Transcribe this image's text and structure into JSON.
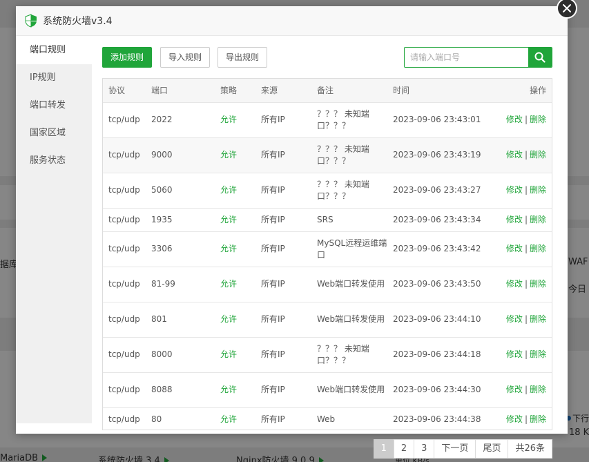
{
  "background": {
    "left_fragment": "据库",
    "right_fragment_1": "WAF",
    "right_fragment_2": "今日",
    "right_fragment_3": "下行",
    "right_fragment_4": "18 K",
    "bottom_items": [
      "MariaDB",
      "系统防火墙 3.4",
      "Nginx防火墙 9.0.9"
    ],
    "bottom_fragment": "单位 KB/s"
  },
  "dialog": {
    "title": "系统防火墙v3.4",
    "sidebar": [
      "端口规则",
      "IP规则",
      "端口转发",
      "国家区域",
      "服务状态"
    ],
    "toolbar": {
      "add_rule": "添加规则",
      "import_rule": "导入规则",
      "export_rule": "导出规则",
      "search_placeholder": "请输入端口号"
    },
    "columns": [
      "协议",
      "端口",
      "策略",
      "来源",
      "备注",
      "时间",
      "操作"
    ],
    "rows": [
      {
        "protocol": "tcp/udp",
        "port": "2022",
        "policy": "允许",
        "source": "所有IP",
        "note": "？？？ 未知端口？？？",
        "time": "2023-09-06 23:43:01"
      },
      {
        "protocol": "tcp/udp",
        "port": "9000",
        "policy": "允许",
        "source": "所有IP",
        "note": "？？？ 未知端口？？？",
        "time": "2023-09-06 23:43:19"
      },
      {
        "protocol": "tcp/udp",
        "port": "5060",
        "policy": "允许",
        "source": "所有IP",
        "note": "？？？ 未知端口？？？",
        "time": "2023-09-06 23:43:27"
      },
      {
        "protocol": "tcp/udp",
        "port": "1935",
        "policy": "允许",
        "source": "所有IP",
        "note": "SRS",
        "time": "2023-09-06 23:43:34"
      },
      {
        "protocol": "tcp/udp",
        "port": "3306",
        "policy": "允许",
        "source": "所有IP",
        "note": "MySQL远程运维端口",
        "time": "2023-09-06 23:43:42"
      },
      {
        "protocol": "tcp/udp",
        "port": "81-99",
        "policy": "允许",
        "source": "所有IP",
        "note": "Web端口转发使用",
        "time": "2023-09-06 23:43:50"
      },
      {
        "protocol": "tcp/udp",
        "port": "801",
        "policy": "允许",
        "source": "所有IP",
        "note": "Web端口转发使用",
        "time": "2023-09-06 23:44:10"
      },
      {
        "protocol": "tcp/udp",
        "port": "8000",
        "policy": "允许",
        "source": "所有IP",
        "note": "？？？ 未知端口？？？",
        "time": "2023-09-06 23:44:18"
      },
      {
        "protocol": "tcp/udp",
        "port": "8088",
        "policy": "允许",
        "source": "所有IP",
        "note": "Web端口转发使用",
        "time": "2023-09-06 23:44:30"
      },
      {
        "protocol": "tcp/udp",
        "port": "80",
        "policy": "允许",
        "source": "所有IP",
        "note": "Web",
        "time": "2023-09-06 23:44:38"
      }
    ],
    "actions": {
      "edit": "修改",
      "separator": "|",
      "delete": "删除"
    },
    "pagination": {
      "pages": [
        "1",
        "2",
        "3"
      ],
      "next": "下一页",
      "last": "尾页",
      "total": "共26条"
    }
  },
  "colors": {
    "accent": "#20a53a",
    "sidebar_bg": "#f0f0f0",
    "header_bg": "#f8f8f8"
  }
}
